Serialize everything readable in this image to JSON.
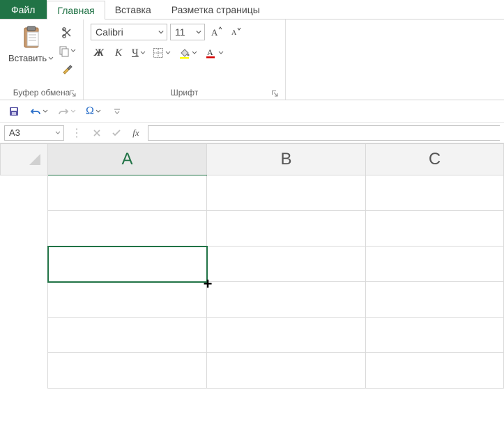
{
  "tabs": {
    "file": "Файл",
    "home": "Главная",
    "insert": "Вставка",
    "layout": "Разметка страницы"
  },
  "clipboard": {
    "paste": "Вставить",
    "group_label": "Буфер обмена"
  },
  "font": {
    "name": "Calibri",
    "size": "11",
    "group_label": "Шрифт",
    "bold": "Ж",
    "italic": "К",
    "underline": "Ч"
  },
  "namebox": {
    "value": "A3"
  },
  "fx_label": "fx",
  "columns": {
    "a": "A",
    "b": "B",
    "c": "C"
  },
  "selected_cell": "A3"
}
